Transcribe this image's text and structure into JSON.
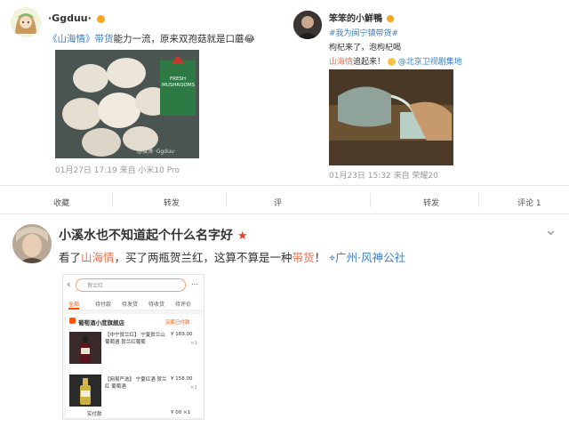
{
  "post_a": {
    "username": "·Ggduu·",
    "text_prefix": "《",
    "text_link": "山海情",
    "text_mid": "》",
    "text_tag": "带货",
    "text_rest": "能力一流，原来双孢菇就是口蘑",
    "emoji": "😂",
    "package_label_top": "FRESH",
    "package_label_bottom": "MUSHROOMS",
    "watermark": "@微博 ·Ggduu·",
    "meta": "01月27日 17:19  来自 小米10 Pro"
  },
  "post_b": {
    "username": "笨笨的小鮮鴨",
    "hashtag": "#我为闽宁镇带货#",
    "line2": "枸杞来了，泡枸杞喝",
    "line3_link": "山海情",
    "line3_rest": "追起来！",
    "mention": "@北京卫视剧集地",
    "meta": "01月23日 15:32  来自 荣耀20"
  },
  "actions_bar": {
    "left": [
      "收藏",
      "转发",
      "评"
    ],
    "right": [
      "转发",
      "评论 1"
    ]
  },
  "post_c": {
    "username": "小溪水也不知道起个什么名字好",
    "text_a": "看了",
    "text_link": "山海情",
    "text_b": "，买了两瓶贺兰红，这算不算是一种",
    "text_tag": "带货",
    "text_c": "！",
    "location": "广州·风神公社",
    "chevron": "⌄"
  },
  "phone": {
    "search_placeholder": "贺兰红",
    "tabs": [
      "全部",
      "待付款",
      "待发货",
      "待收货",
      "待评价"
    ],
    "shop_name": "葡萄酒小度旗舰店",
    "shop_status": "买家已付款",
    "items": [
      {
        "title": "【中宁贺兰红】 宁夏贺兰山葡萄酒 贺兰红葡萄",
        "price": "¥ 169.00",
        "qty": "×1"
      },
      {
        "title": "【网易严选】 宁夏红酒 贺兰红 葡萄酒",
        "price": "¥ 158.00",
        "qty": "×1"
      }
    ],
    "footer_label": "实付款",
    "footer_total": "¥ 00 ×1"
  },
  "colors": {
    "accent": "#eb7350",
    "link": "#3b7fc4"
  }
}
